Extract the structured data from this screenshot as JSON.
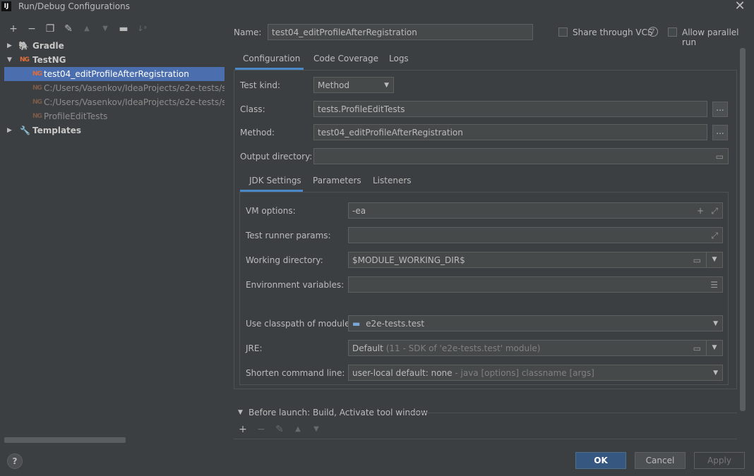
{
  "window": {
    "title": "Run/Debug Configurations",
    "app_logo": "IJ"
  },
  "toolbar": {
    "icons": [
      "plus-icon",
      "minus-icon",
      "copy-icon",
      "wrench-icon",
      "arrow-up-icon",
      "arrow-down-icon",
      "new-folder-icon",
      "sort-icon"
    ]
  },
  "tree": {
    "gradle": "Gradle",
    "testng": "TestNG",
    "items": [
      {
        "label": "test04_editProfileAfterRegistration"
      },
      {
        "label": "C:/Users/Vasenkov/IdeaProjects/e2e-tests/src/te"
      },
      {
        "label": "C:/Users/Vasenkov/IdeaProjects/e2e-tests/src/te"
      },
      {
        "label": "ProfileEditTests"
      }
    ],
    "ng_badge": "NG",
    "templates": "Templates"
  },
  "name_row": {
    "label": "Name:",
    "value": "test04_editProfileAfterRegistration",
    "share_vcs": "Share through VCS",
    "allow_parallel": "Allow parallel run"
  },
  "main_tabs": [
    "Configuration",
    "Code Coverage",
    "Logs"
  ],
  "config": {
    "test_kind_label": "Test kind:",
    "test_kind_value": "Method",
    "class_label": "Class:",
    "class_value": "tests.ProfileEditTests",
    "method_label": "Method:",
    "method_value": "test04_editProfileAfterRegistration",
    "output_dir_label": "Output directory:",
    "output_dir_value": "",
    "dots": "..."
  },
  "sub_tabs": [
    "JDK Settings",
    "Parameters",
    "Listeners"
  ],
  "jdk": {
    "vm_label": "VM options:",
    "vm_value": "-ea",
    "runner_label": "Test runner params:",
    "runner_value": "",
    "workdir_label": "Working directory:",
    "workdir_value": "$MODULE_WORKING_DIR$",
    "env_label": "Environment variables:",
    "env_value": "",
    "classpath_label": "Use classpath of module:",
    "classpath_value": "e2e-tests.test",
    "jre_label": "JRE:",
    "jre_value": "Default",
    "jre_hint": "(11 - SDK of 'e2e-tests.test' module)",
    "shorten_label": "Shorten command line:",
    "shorten_value": "user-local default: none",
    "shorten_hint": "- java [options] classname [args]"
  },
  "before_launch": {
    "label": "Before launch: Build, Activate tool window"
  },
  "buttons": {
    "ok": "OK",
    "cancel": "Cancel",
    "apply": "Apply",
    "help": "?"
  },
  "colors": {
    "accent": "#4a88c7",
    "selection": "#4b6eaf",
    "ok_button": "#365880"
  }
}
